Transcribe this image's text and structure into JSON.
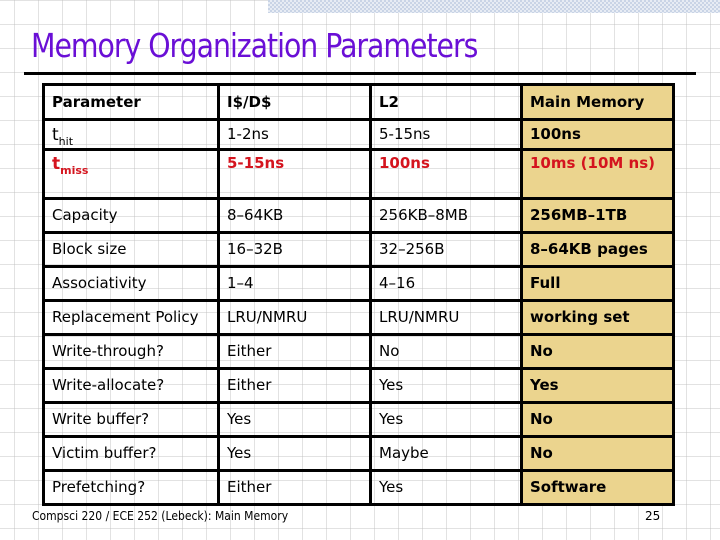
{
  "slide": {
    "title": "Memory Organization Parameters",
    "footer": "Compsci 220 / ECE 252 (Lebeck): Main Memory",
    "page_number": "25"
  },
  "colors": {
    "title": "#6a0fd6",
    "highlight_column_bg": "#ebd48e",
    "miss_row_text": "#d4141e"
  },
  "table": {
    "headers": [
      "Parameter",
      "I$/D$",
      "L2",
      "Main Memory"
    ],
    "rows": [
      {
        "param": {
          "base": "t",
          "sub": "hit"
        },
        "cells": [
          "1-2ns",
          "5-15ns",
          "100ns"
        ]
      },
      {
        "param": {
          "base": "t",
          "sub": "miss"
        },
        "cells": [
          "5-15ns",
          "100ns",
          "10ms (10M ns)"
        ]
      },
      {
        "param": "Capacity",
        "cells": [
          "8–64KB",
          "256KB–8MB",
          "256MB–1TB"
        ]
      },
      {
        "param": "Block size",
        "cells": [
          "16–32B",
          "32–256B",
          "8–64KB pages"
        ]
      },
      {
        "param": "Associativity",
        "cells": [
          "1–4",
          "4–16",
          "Full"
        ]
      },
      {
        "param": "Replacement Policy",
        "cells": [
          "LRU/NMRU",
          "LRU/NMRU",
          "working set"
        ]
      },
      {
        "param": "Write-through?",
        "cells": [
          "Either",
          "No",
          "No"
        ]
      },
      {
        "param": "Write-allocate?",
        "cells": [
          "Either",
          "Yes",
          "Yes"
        ]
      },
      {
        "param": "Write buffer?",
        "cells": [
          "Yes",
          "Yes",
          "No"
        ]
      },
      {
        "param": "Victim buffer?",
        "cells": [
          "Yes",
          "Maybe",
          "No"
        ]
      },
      {
        "param": "Prefetching?",
        "cells": [
          "Either",
          "Yes",
          "Software"
        ]
      }
    ]
  }
}
